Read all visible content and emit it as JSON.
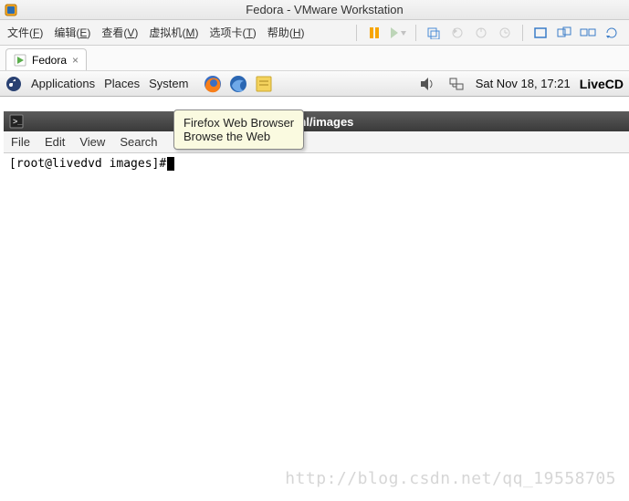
{
  "window": {
    "title": "Fedora - VMware Workstation"
  },
  "vmware_menu": {
    "file": "文件",
    "file_k": "F",
    "edit": "编辑",
    "edit_k": "E",
    "view": "查看",
    "view_k": "V",
    "vm": "虚拟机",
    "vm_k": "M",
    "tabs": "选项卡",
    "tabs_k": "T",
    "help": "帮助",
    "help_k": "H"
  },
  "vmware_icons": {
    "pause": "pause-icon",
    "play": "play-dropdown-icon",
    "snapshot": "snapshot-icon",
    "revert": "revert-icon",
    "manage": "manage-snapshot-icon",
    "clock": "clock-icon",
    "fullscreen": "fullscreen-icon",
    "unity": "unity-icon",
    "multimon": "multimon-icon",
    "cycle": "cycle-icon"
  },
  "tab": {
    "label": "Fedora",
    "close": "×"
  },
  "gnome": {
    "apps": "Applications",
    "places": "Places",
    "system": "System",
    "datetime": "Sat Nov 18, 17:21",
    "livecd": "LiveCD"
  },
  "launchers": {
    "firefox": "firefox-icon",
    "thunderbird": "thunderbird-icon",
    "notes": "notes-icon",
    "sound": "sound-icon",
    "network": "network-icon"
  },
  "tooltip": {
    "line1": "Firefox Web Browser",
    "line2": "Browse the Web"
  },
  "terminal": {
    "title_gap": "                                                  ",
    "title_path": "/usr/local/nginx/html/images",
    "menu": {
      "file": "File",
      "edit": "Edit",
      "view": "View",
      "search": "Search"
    },
    "prompt": "[root@livedvd images]# "
  },
  "watermark": "http://blog.csdn.net/qq_19558705"
}
